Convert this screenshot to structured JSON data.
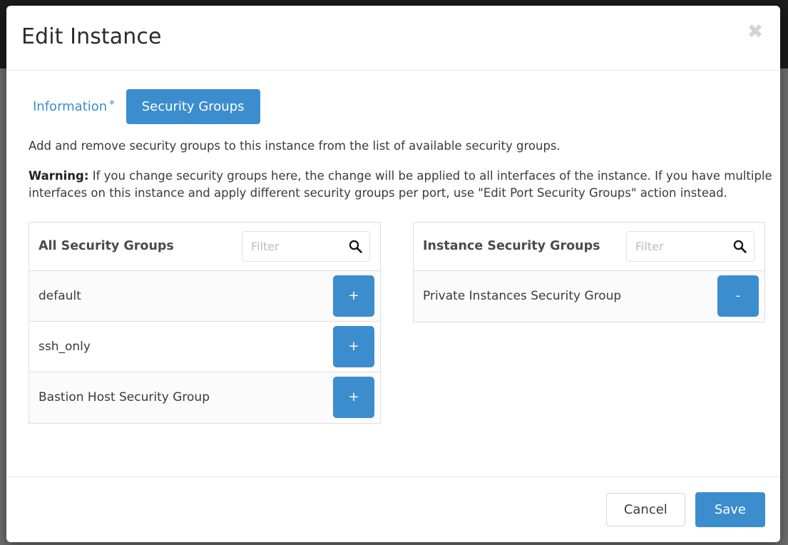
{
  "modal": {
    "title": "Edit Instance",
    "close_icon": "close-icon"
  },
  "tabs": [
    {
      "label": "Information",
      "required_marker": "*",
      "active": false
    },
    {
      "label": "Security Groups",
      "required_marker": "",
      "active": true
    }
  ],
  "body": {
    "description": "Add and remove security groups to this instance from the list of available security groups.",
    "warning_label": "Warning:",
    "warning_text": " If you change security groups here, the change will be applied to all interfaces of the instance. If you have multiple interfaces on this instance and apply different security groups per port, use \"Edit Port Security Groups\" action instead."
  },
  "panels": {
    "available": {
      "title": "All Security Groups",
      "filter_placeholder": "Filter",
      "filter_value": "",
      "search_icon": "search-icon",
      "rows": [
        {
          "name": "default",
          "action": "+"
        },
        {
          "name": "ssh_only",
          "action": "+"
        },
        {
          "name": "Bastion Host Security Group",
          "action": "+"
        }
      ]
    },
    "assigned": {
      "title": "Instance Security Groups",
      "filter_placeholder": "Filter",
      "filter_value": "",
      "search_icon": "search-icon",
      "rows": [
        {
          "name": "Private Instances Security Group",
          "action": "-"
        }
      ]
    }
  },
  "footer": {
    "cancel_label": "Cancel",
    "save_label": "Save"
  },
  "colors": {
    "primary": "#3c8dce",
    "text": "#3a3a3a",
    "border": "#dedede",
    "row_stripe": "#fbfbfb",
    "backdrop_top": "#1b1b1b",
    "backdrop_bottom": "#6e6e6e"
  }
}
